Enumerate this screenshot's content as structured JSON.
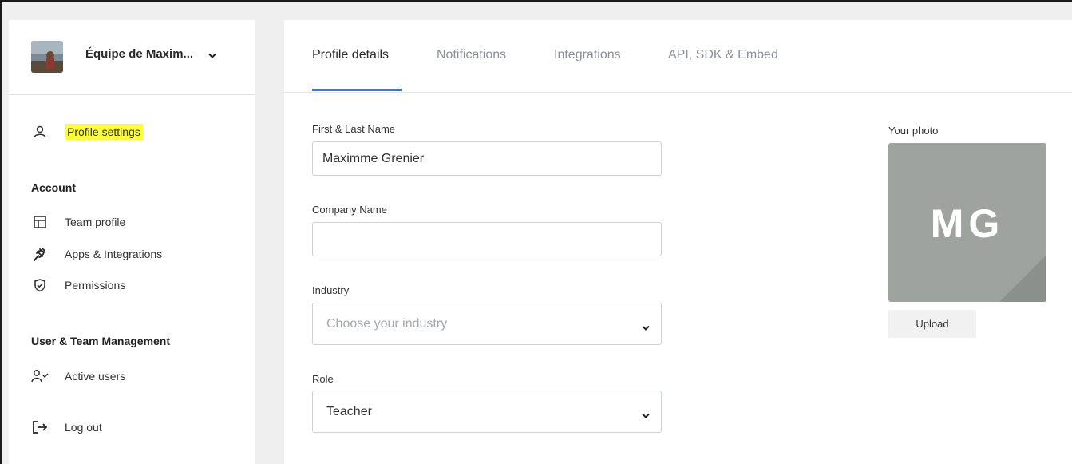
{
  "colors": {
    "accent": "#3f78c8",
    "highlight": "#ffff3a",
    "avatar_bg": "#9ea3a0"
  },
  "sidebar": {
    "team_name": "Équipe de Maxim...",
    "profile_settings": "Profile settings",
    "account": {
      "title": "Account",
      "items": [
        {
          "label": "Team profile",
          "icon": "layout-icon"
        },
        {
          "label": "Apps & Integrations",
          "icon": "plug-icon"
        },
        {
          "label": "Permissions",
          "icon": "shield-check-icon"
        }
      ]
    },
    "management": {
      "title": "User & Team Management",
      "items": [
        {
          "label": "Active users",
          "icon": "user-check-icon"
        }
      ]
    },
    "logout": "Log out"
  },
  "tabs": [
    "Profile details",
    "Notifications",
    "Integrations",
    "API, SDK & Embed"
  ],
  "form": {
    "name_label": "First & Last Name",
    "name_value": "Maximme Grenier",
    "company_label": "Company Name",
    "company_value": "",
    "industry_label": "Industry",
    "industry_placeholder": "Choose your industry",
    "role_label": "Role",
    "role_value": "Teacher"
  },
  "photo": {
    "label": "Your photo",
    "initials": "MG",
    "upload": "Upload"
  }
}
